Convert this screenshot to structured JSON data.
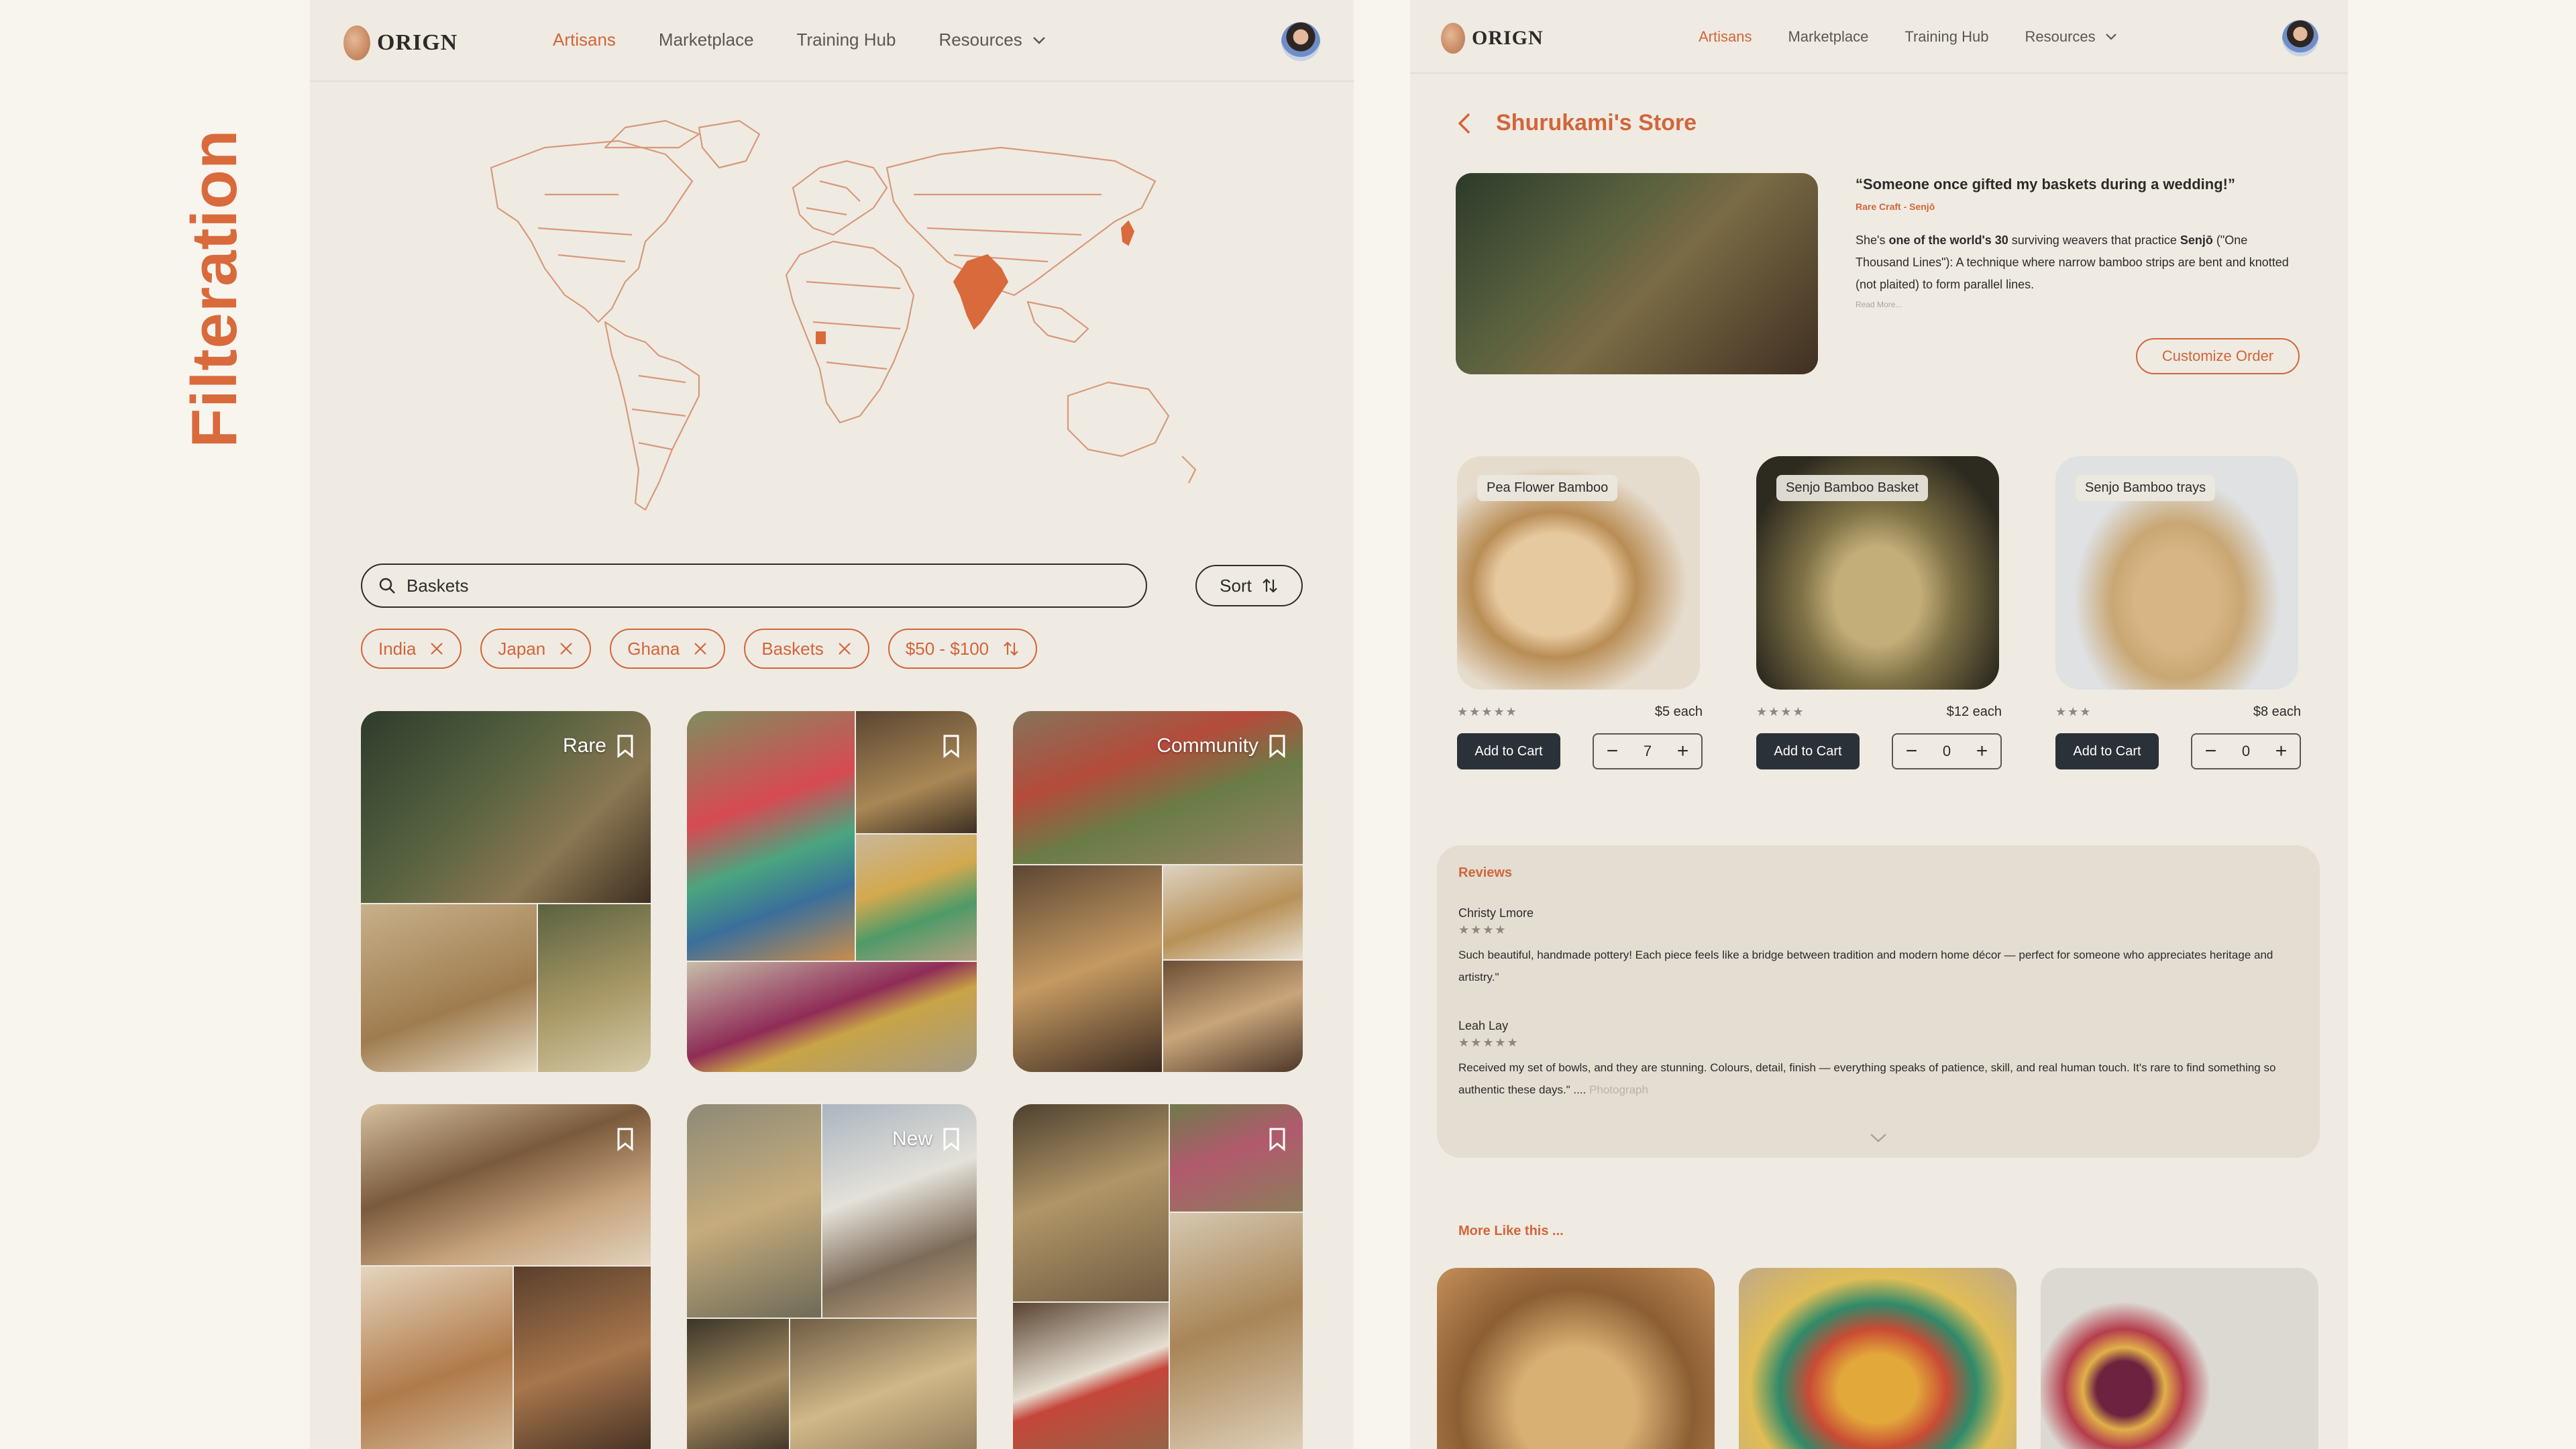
{
  "page_title": "Filteration",
  "brand": {
    "name": "ORIGN"
  },
  "nav": {
    "links": [
      "Artisans",
      "Marketplace",
      "Training Hub",
      "Resources"
    ],
    "active": "Artisans"
  },
  "left": {
    "map": {
      "highlighted_countries": [
        "India",
        "Japan",
        "Ghana"
      ],
      "highlight_color": "#d96a3c"
    },
    "search": {
      "value": "Baskets"
    },
    "sort_label": "Sort",
    "chips": [
      "India",
      "Japan",
      "Ghana",
      "Baskets",
      "$50 - $100"
    ],
    "tiles": [
      {
        "tag": "Rare"
      },
      {
        "tag": ""
      },
      {
        "tag": "Community"
      },
      {
        "tag": ""
      },
      {
        "tag": "New"
      },
      {
        "tag": ""
      }
    ]
  },
  "store": {
    "title": "Shurukami's Store",
    "quote": "“Someone once gifted my baskets during a wedding!”",
    "quote_source": "Rare Craft - Senjō",
    "desc_1": "She's ",
    "desc_bold_1": "one of the world's 30",
    "desc_2": " surviving weavers that practice ",
    "desc_bold_2": "Senjō",
    "desc_3": " (\"One Thousand Lines\"): A technique where narrow bamboo strips are bent and knotted (not plaited) to form parallel lines.",
    "read_more": "Read More...",
    "customize_label": "Customize Order",
    "products": [
      {
        "name": "Pea Flower Bamboo",
        "stars": "★★★★★",
        "price": "$5 each",
        "qty": "7",
        "cart": "Add to Cart"
      },
      {
        "name": "Senjo Bamboo Basket",
        "stars": "★★★★",
        "price": "$12 each",
        "qty": "0",
        "cart": "Add to Cart"
      },
      {
        "name": "Senjo Bamboo trays",
        "stars": "★★★",
        "price": "$8 each",
        "qty": "0",
        "cart": "Add to Cart"
      }
    ]
  },
  "reviews": {
    "heading": "Reviews",
    "items": [
      {
        "name": "Christy Lmore",
        "stars": "★★★★",
        "text": "Such beautiful, handmade pottery! Each piece feels like a bridge between tradition and modern home décor — perfect for someone who appreciates heritage and artistry.\"",
        "faded": ""
      },
      {
        "name": "Leah Lay",
        "stars": "★★★★★",
        "text": "Received my set of bowls, and they are stunning. Colours, detail, finish — everything speaks of patience, skill, and real human touch. It's rare to find something so authentic these days.\" .... ",
        "faded": "Photograph"
      }
    ]
  },
  "more_like": {
    "heading": "More Like this ..."
  }
}
